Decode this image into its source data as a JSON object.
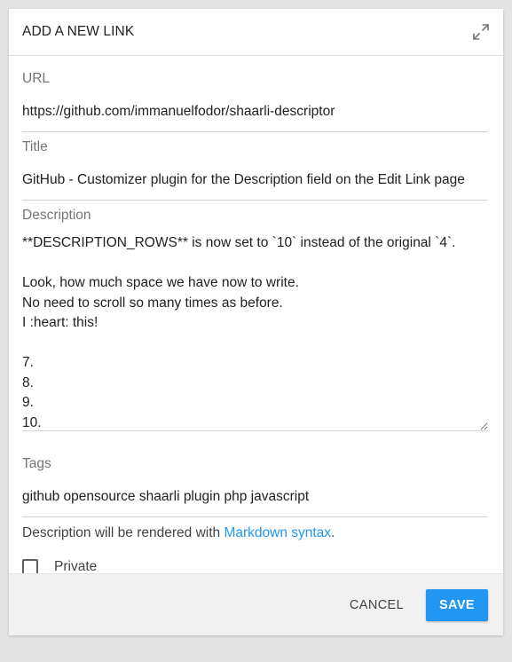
{
  "dialog": {
    "title": "ADD A NEW LINK",
    "expand_icon": "expand-icon"
  },
  "fields": {
    "url": {
      "label": "URL",
      "value": "https://github.com/immanuelfodor/shaarli-descriptor"
    },
    "title": {
      "label": "Title",
      "value": "GitHub - Customizer plugin for the Description field on the Edit Link page"
    },
    "description": {
      "label": "Description",
      "value": "**DESCRIPTION_ROWS** is now set to `10` instead of the original `4`.\n\nLook, how much space we have now to write.\nNo need to scroll so many times as before.\nI :heart: this!\n\n7.\n8.\n9.\n10."
    },
    "tags": {
      "label": "Tags",
      "value": "github opensource shaarli plugin php javascript"
    }
  },
  "note": {
    "prefix": "Description will be rendered with ",
    "link": "Markdown syntax",
    "suffix": "."
  },
  "private": {
    "label": "Private",
    "checked": false
  },
  "buttons": {
    "cancel": "CANCEL",
    "save": "SAVE"
  },
  "colors": {
    "accent": "#2196f3",
    "footer_bg": "#f1f1f1",
    "page_bg": "#e4e4e4"
  }
}
